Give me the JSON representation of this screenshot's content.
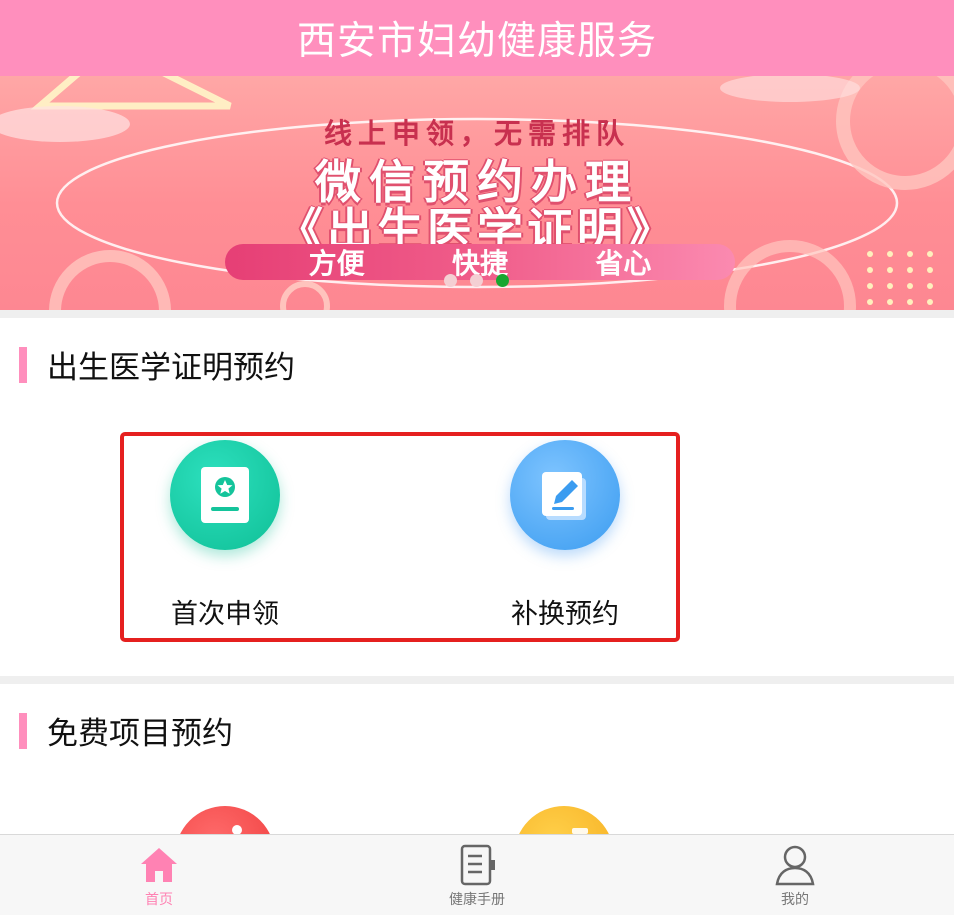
{
  "header": {
    "title": "西安市妇幼健康服务"
  },
  "banner": {
    "line1": "线上申领，无需排队",
    "line2": "微信预约办理",
    "line3": "《出生医学证明》",
    "tags": [
      "方便",
      "快捷",
      "省心"
    ],
    "carousel": {
      "total": 3,
      "active_index": 2
    }
  },
  "sections": [
    {
      "title": "出生医学证明预约",
      "items": [
        {
          "label": "首次申领",
          "icon": "certificate-star-icon",
          "color": "#1ccaa4"
        },
        {
          "label": "补换预约",
          "icon": "edit-note-icon",
          "color": "#48a8f5"
        }
      ]
    },
    {
      "title": "免费项目预约",
      "items": [
        {
          "icon": "info-icon",
          "color": "#f24a4a"
        },
        {
          "icon": "document-icon",
          "color": "#f8b72e"
        }
      ]
    }
  ],
  "tabbar": {
    "active": "home",
    "items": [
      {
        "key": "home",
        "label": "首页",
        "icon": "home-icon"
      },
      {
        "key": "handbook",
        "label": "健康手册",
        "icon": "notebook-icon"
      },
      {
        "key": "mine",
        "label": "我的",
        "icon": "user-icon"
      }
    ]
  },
  "colors": {
    "brand_pink": "#ff8fbd",
    "highlight_red": "#e5201f",
    "active_dot": "#18a630"
  }
}
